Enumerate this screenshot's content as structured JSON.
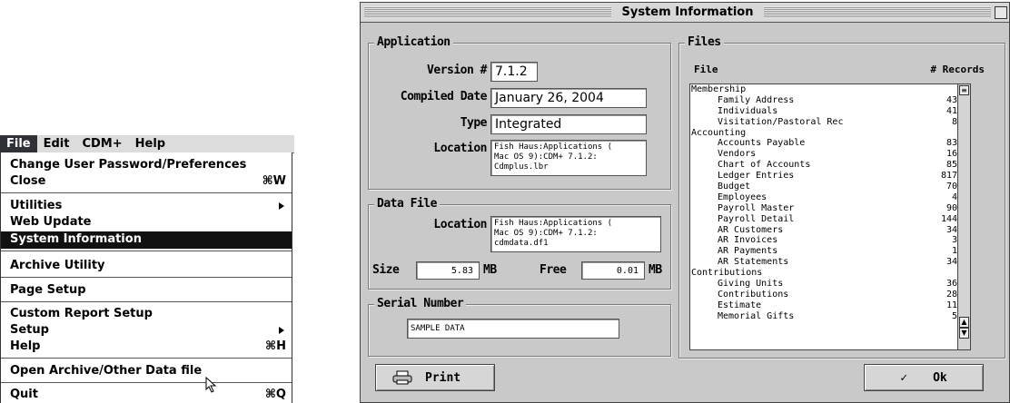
{
  "menubar": {
    "items": [
      "File",
      "Edit",
      "CDM+",
      "Help"
    ]
  },
  "file_menu": {
    "items": [
      {
        "label": "Change User Password/Preferences",
        "shortcut": ""
      },
      {
        "label": "Close",
        "shortcut": "⌘W"
      },
      {
        "label": "Utilities",
        "shortcut": ""
      },
      {
        "label": "Web Update",
        "shortcut": ""
      },
      {
        "label": "System Information",
        "shortcut": ""
      },
      {
        "label": "Archive Utility",
        "shortcut": ""
      },
      {
        "label": "Page Setup",
        "shortcut": ""
      },
      {
        "label": "Custom Report Setup",
        "shortcut": ""
      },
      {
        "label": "Setup",
        "shortcut": ""
      },
      {
        "label": "Help",
        "shortcut": "⌘H"
      },
      {
        "label": "Open Archive/Other Data file",
        "shortcut": ""
      },
      {
        "label": "Quit",
        "shortcut": "⌘Q"
      }
    ]
  },
  "window": {
    "title": "System Information"
  },
  "application": {
    "title": "Application",
    "version_label": "Version #",
    "version": "7.1.2",
    "compiled_label": "Compiled Date",
    "compiled": "January 26, 2004",
    "type_label": "Type",
    "type": "Integrated",
    "location_label": "Location",
    "location": "Fish Haus:Applications (\nMac OS 9):CDM+ 7.1.2:\nCdmplus.lbr"
  },
  "data_file": {
    "title": "Data File",
    "location_label": "Location",
    "location": "Fish Haus:Applications (\nMac OS 9):CDM+ 7.1.2:\ncdmdata.df1",
    "size_label": "Size",
    "size": "5.83",
    "size_unit": "MB",
    "free_label": "Free",
    "free": "0.01",
    "free_unit": "MB"
  },
  "serial": {
    "title": "Serial Number",
    "value": "SAMPLE DATA"
  },
  "files": {
    "title": "Files",
    "col_file": "File",
    "col_records": "# Records",
    "rows": [
      {
        "name": "Membership",
        "count": "",
        "cat": true
      },
      {
        "name": "Family Address",
        "count": "43"
      },
      {
        "name": "Individuals",
        "count": "41"
      },
      {
        "name": "Visitation/Pastoral Rec",
        "count": "8"
      },
      {
        "name": "Accounting",
        "count": "",
        "cat": true
      },
      {
        "name": "Accounts Payable",
        "count": "83"
      },
      {
        "name": "Vendors",
        "count": "16"
      },
      {
        "name": "Chart of Accounts",
        "count": "85"
      },
      {
        "name": "Ledger Entries",
        "count": "817"
      },
      {
        "name": "Budget",
        "count": "70"
      },
      {
        "name": "Employees",
        "count": "4"
      },
      {
        "name": "Payroll Master",
        "count": "90"
      },
      {
        "name": "Payroll Detail",
        "count": "144"
      },
      {
        "name": "AR Customers",
        "count": "34"
      },
      {
        "name": "AR Invoices",
        "count": "3"
      },
      {
        "name": "AR Payments",
        "count": "1"
      },
      {
        "name": "AR Statements",
        "count": "34"
      },
      {
        "name": "Contributions",
        "count": "",
        "cat": true
      },
      {
        "name": "Giving Units",
        "count": "36"
      },
      {
        "name": "Contributions",
        "count": "28"
      },
      {
        "name": "Estimate",
        "count": "11"
      },
      {
        "name": "Memorial Gifts",
        "count": "5"
      }
    ]
  },
  "buttons": {
    "print": "Print",
    "ok": "Ok"
  }
}
